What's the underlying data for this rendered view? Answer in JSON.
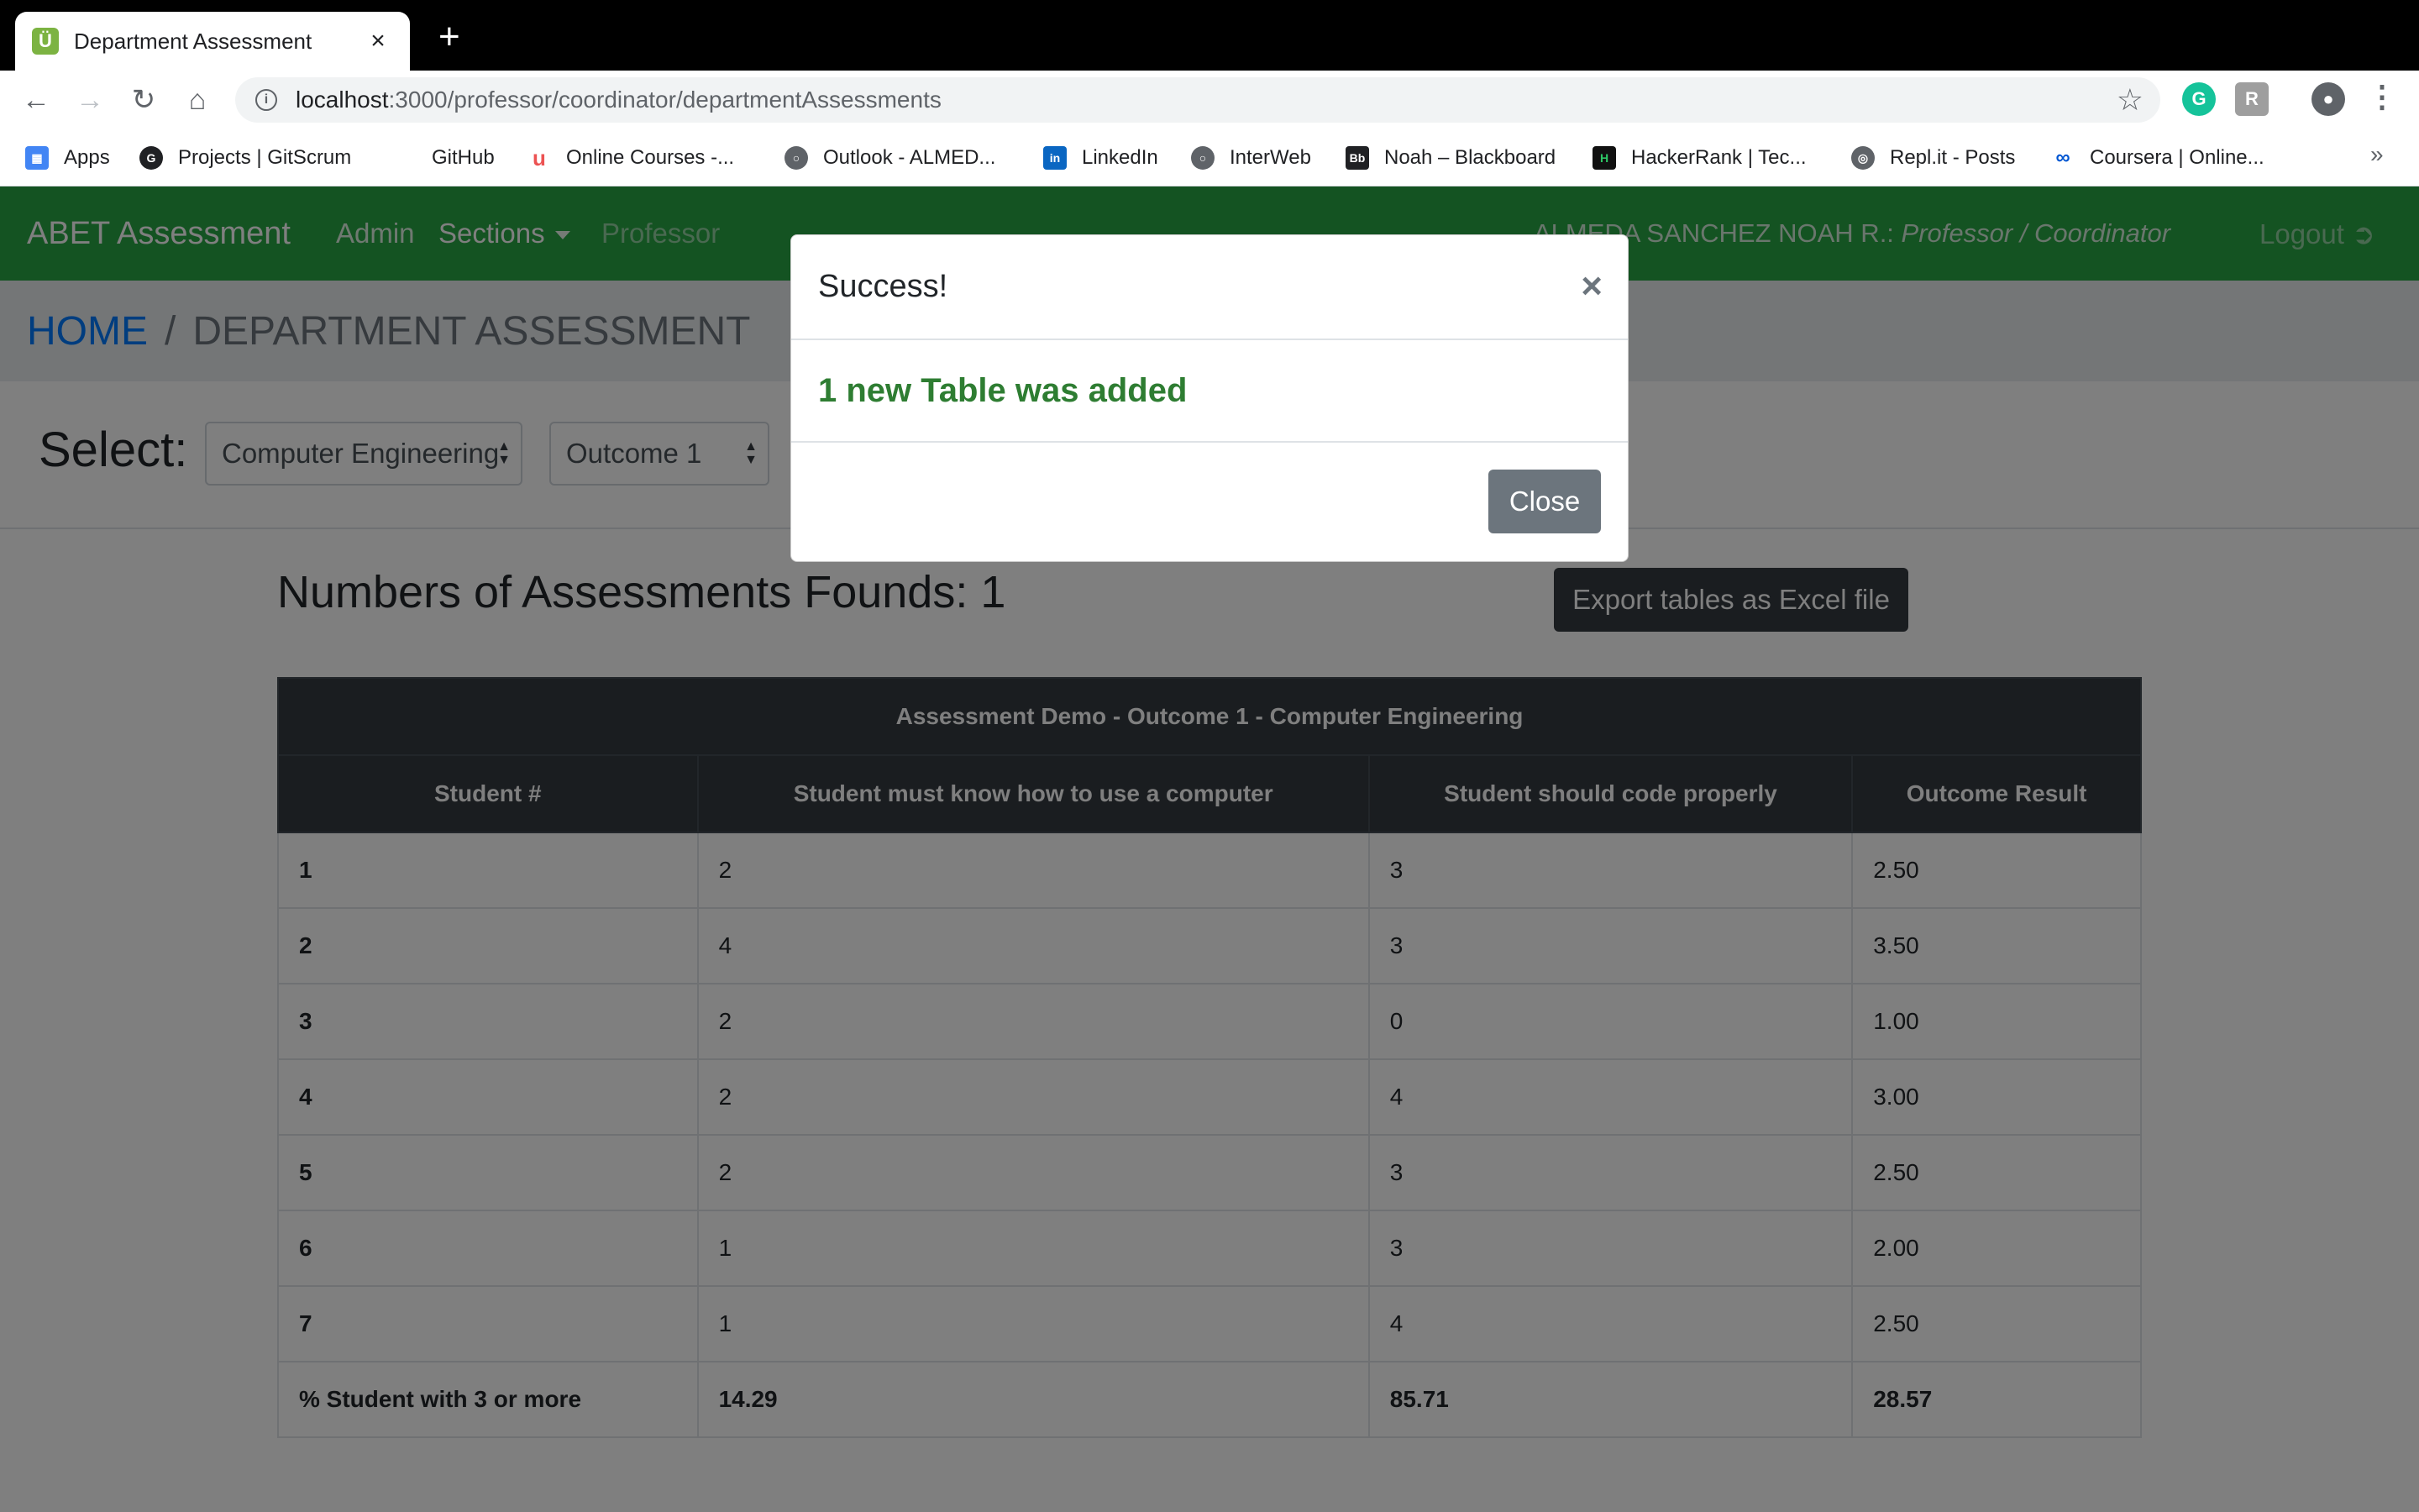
{
  "browser": {
    "tab_title": "Department Assessment",
    "tab_favicon": "Ü",
    "tab_close": "×",
    "new_tab": "+",
    "url_host": "localhost",
    "url_path": ":3000/professor/coordinator/departmentAssessments",
    "bookmarks": [
      {
        "label": "Apps",
        "icon": "apps-grid-icon"
      },
      {
        "label": "Projects | GitScrum",
        "icon": "gitscrum-icon"
      },
      {
        "label": "GitHub",
        "icon": "github-icon"
      },
      {
        "label": "Online Courses -...",
        "icon": "udemy-icon"
      },
      {
        "label": "Outlook - ALMED...",
        "icon": "globe-icon"
      },
      {
        "label": "LinkedIn",
        "icon": "linkedin-icon"
      },
      {
        "label": "InterWeb",
        "icon": "globe-icon"
      },
      {
        "label": "Noah – Blackboard",
        "icon": "blackboard-icon"
      },
      {
        "label": "HackerRank | Tec...",
        "icon": "hackerrank-icon"
      },
      {
        "label": "Repl.it - Posts",
        "icon": "replit-icon"
      },
      {
        "label": "Coursera | Online...",
        "icon": "coursera-icon"
      }
    ],
    "bookmarks_more": "»"
  },
  "navbar": {
    "brand": "ABET Assessment",
    "links": [
      "Admin",
      "Sections",
      "Professor"
    ],
    "user_name": "ALMEDA SANCHEZ NOAH R.:",
    "user_role": "Professor / Coordinator",
    "logout": "Logout"
  },
  "breadcrumb": {
    "home": "HOME",
    "separator": "/",
    "current": "DEPARTMENT ASSESSMENT"
  },
  "filters": {
    "label": "Select:",
    "department": "Computer Engineering",
    "outcome": "Outcome 1"
  },
  "main": {
    "count_title": "Numbers of Assessments Founds: 1",
    "export_button": "Export tables as Excel file"
  },
  "table": {
    "caption": "Assessment Demo - Outcome 1 - Computer Engineering",
    "headers": [
      "Student #",
      "Student must know how to use a computer",
      "Student should code properly",
      "Outcome Result"
    ],
    "rows": [
      [
        "1",
        "2",
        "3",
        "2.50"
      ],
      [
        "2",
        "4",
        "3",
        "3.50"
      ],
      [
        "3",
        "2",
        "0",
        "1.00"
      ],
      [
        "4",
        "2",
        "4",
        "3.00"
      ],
      [
        "5",
        "2",
        "3",
        "2.50"
      ],
      [
        "6",
        "1",
        "3",
        "2.00"
      ],
      [
        "7",
        "1",
        "4",
        "2.50"
      ]
    ],
    "summary": [
      "% Student with 3 or more",
      "14.29",
      "85.71",
      "28.57"
    ]
  },
  "modal": {
    "title": "Success!",
    "close_x": "×",
    "message": "1 new Table was added",
    "button": "Close"
  },
  "colors": {
    "navbar": "#28a745",
    "table_header": "#343a40",
    "success_text": "#2e7d32",
    "link": "#007bff"
  }
}
